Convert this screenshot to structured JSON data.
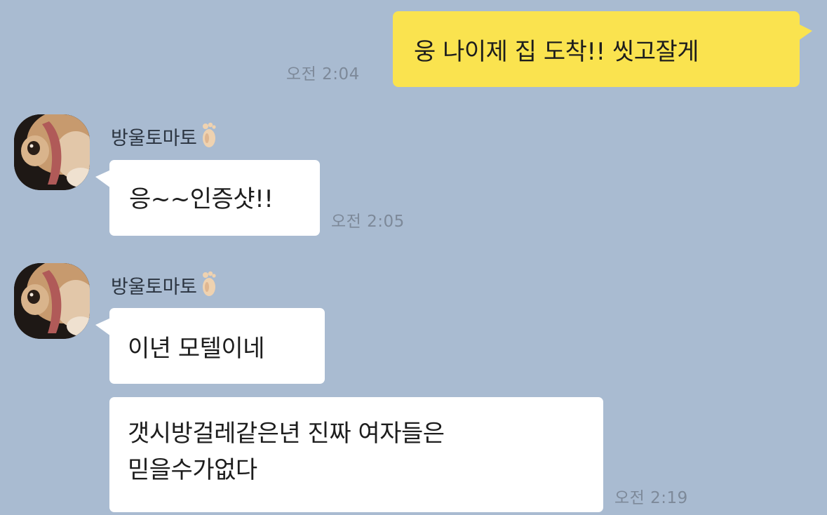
{
  "messages": {
    "outgoing": {
      "text": "웅 나이제 집 도착!! 씻고잘게",
      "time": "오전 2:04"
    },
    "group1": {
      "sender": "방울토마토",
      "text": "응~~인증샷!!",
      "time": "오전 2:05"
    },
    "group2": {
      "sender": "방울토마토",
      "text1": "이년 모텔이네",
      "text2_line1": "갯시방걸레같은년 진짜 여자들은",
      "text2_line2": "믿을수가없다",
      "time": "오전 2:19"
    }
  },
  "icons": {
    "sender_badge": "foot-icon",
    "avatar": "puppy-photo"
  },
  "colors": {
    "background": "#a9bbd1",
    "outgoing_bubble": "#fae34f",
    "incoming_bubble": "#ffffff",
    "timestamp": "#7d8999"
  }
}
